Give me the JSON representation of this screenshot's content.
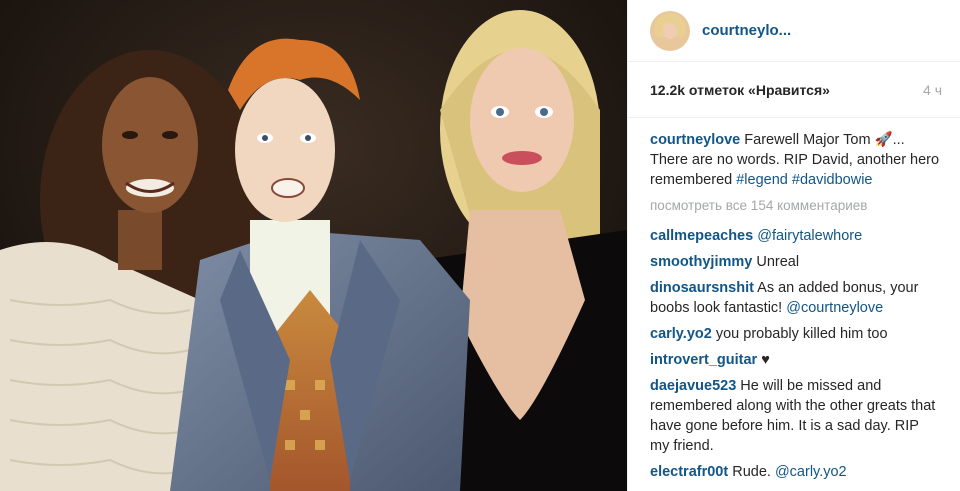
{
  "post": {
    "photo_description": "photo-of-three-people",
    "author": "courtneylo...",
    "likes": "12.2k отметок «Нравится»",
    "time": "4 ч"
  },
  "caption": {
    "author": "courtneylove",
    "text_1": "Farewell Major Tom ",
    "emoji": "🚀",
    "text_2": "... There are no words. RIP David, another hero remembered ",
    "tag_1": "#legend",
    "tag_2": "#davidbowie"
  },
  "view_all": "посмотреть все 154 комментариев",
  "comments": [
    {
      "author": "callmepeaches",
      "text": "",
      "mention": "@fairytalewhore"
    },
    {
      "author": "smoothyjimmy",
      "text": "Unreal",
      "mention": ""
    },
    {
      "author": "dinosaursnshit",
      "text": "As an added bonus, your boobs look fantastic! ",
      "mention": "@courtneylove"
    },
    {
      "author": "carly.yo2",
      "text": "you probably killed him too",
      "mention": ""
    },
    {
      "author": "introvert_guitar",
      "text": "",
      "mention": "",
      "icon": "heart-icon",
      "glyph": "♥"
    },
    {
      "author": "daejavue523",
      "text": "He will be missed and remembered along with the other greats that have gone before him. It is a sad day. RIP my friend.",
      "mention": ""
    },
    {
      "author": "electrafr00t",
      "text": "Rude. ",
      "mention": "@carly.yo2"
    }
  ],
  "colors": {
    "link": "#125688",
    "text": "#262626",
    "muted": "#a5a7aa"
  }
}
